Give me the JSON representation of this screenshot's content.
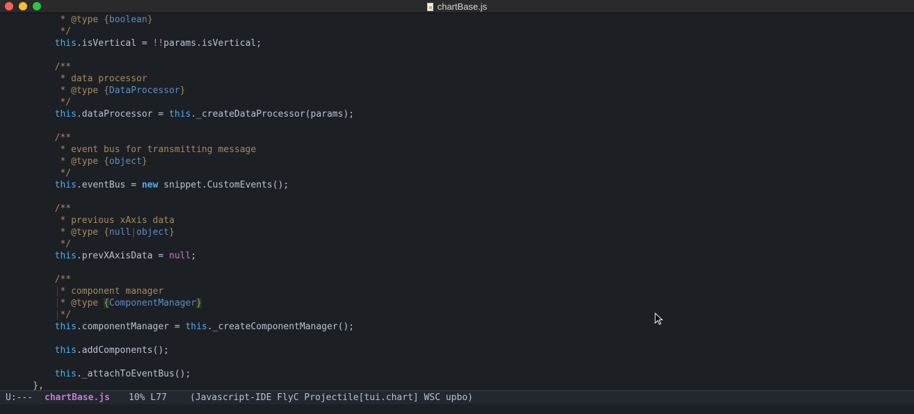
{
  "window": {
    "title": "chartBase.js",
    "traffic_lights": {
      "close": "#fe5f57",
      "minimize": "#febc2e",
      "maximize": "#28c840"
    }
  },
  "editor": {
    "theme": {
      "background": "#1c1f24",
      "comment": "#5b6268",
      "doc_text": "#a78a5c",
      "type": "#5b8fc7",
      "keyword": "#51afef",
      "constant": "#c678dd"
    },
    "lines": [
      {
        "tokens": [
          {
            "t": "         * @type ",
            "c": "tok-doctext"
          },
          {
            "t": "{",
            "c": "tok-brace"
          },
          {
            "t": "boolean",
            "c": "tok-type"
          },
          {
            "t": "}",
            "c": "tok-brace"
          }
        ]
      },
      {
        "tokens": [
          {
            "t": "         */",
            "c": "tok-doctext"
          }
        ]
      },
      {
        "tokens": [
          {
            "t": "        ",
            "c": "tok-ident"
          },
          {
            "t": "this",
            "c": "tok-this"
          },
          {
            "t": ".isVertical = ",
            "c": "tok-ident"
          },
          {
            "t": "!!",
            "c": "tok-bang"
          },
          {
            "t": "params.isVertical;",
            "c": "tok-ident"
          }
        ]
      },
      {
        "tokens": [
          {
            "t": "",
            "c": "tok-ident"
          }
        ]
      },
      {
        "tokens": [
          {
            "t": "        /**",
            "c": "tok-doctext"
          }
        ]
      },
      {
        "tokens": [
          {
            "t": "         * data processor",
            "c": "tok-doctext"
          }
        ]
      },
      {
        "tokens": [
          {
            "t": "         * @type ",
            "c": "tok-doctext"
          },
          {
            "t": "{",
            "c": "tok-brace"
          },
          {
            "t": "DataProcessor",
            "c": "tok-type"
          },
          {
            "t": "}",
            "c": "tok-brace"
          }
        ]
      },
      {
        "tokens": [
          {
            "t": "         */",
            "c": "tok-doctext"
          }
        ]
      },
      {
        "tokens": [
          {
            "t": "        ",
            "c": "tok-ident"
          },
          {
            "t": "this",
            "c": "tok-this"
          },
          {
            "t": ".dataProcessor = ",
            "c": "tok-ident"
          },
          {
            "t": "this",
            "c": "tok-this"
          },
          {
            "t": "._createDataProcessor(params);",
            "c": "tok-ident"
          }
        ]
      },
      {
        "tokens": [
          {
            "t": "",
            "c": "tok-ident"
          }
        ]
      },
      {
        "tokens": [
          {
            "t": "        /**",
            "c": "tok-doctext"
          }
        ]
      },
      {
        "tokens": [
          {
            "t": "         * event bus for transmitting message",
            "c": "tok-doctext"
          }
        ]
      },
      {
        "tokens": [
          {
            "t": "         * @type ",
            "c": "tok-doctext"
          },
          {
            "t": "{",
            "c": "tok-brace"
          },
          {
            "t": "object",
            "c": "tok-type"
          },
          {
            "t": "}",
            "c": "tok-brace"
          }
        ]
      },
      {
        "tokens": [
          {
            "t": "         */",
            "c": "tok-doctext"
          }
        ]
      },
      {
        "tokens": [
          {
            "t": "        ",
            "c": "tok-ident"
          },
          {
            "t": "this",
            "c": "tok-this"
          },
          {
            "t": ".eventBus = ",
            "c": "tok-ident"
          },
          {
            "t": "new",
            "c": "tok-kw"
          },
          {
            "t": " snippet.CustomEvents();",
            "c": "tok-ident"
          }
        ]
      },
      {
        "tokens": [
          {
            "t": "",
            "c": "tok-ident"
          }
        ]
      },
      {
        "tokens": [
          {
            "t": "        /**",
            "c": "tok-doctext"
          }
        ]
      },
      {
        "tokens": [
          {
            "t": "         * previous xAxis data",
            "c": "tok-doctext"
          }
        ]
      },
      {
        "tokens": [
          {
            "t": "         * @type ",
            "c": "tok-doctext"
          },
          {
            "t": "{",
            "c": "tok-brace"
          },
          {
            "t": "null",
            "c": "tok-type"
          },
          {
            "t": "|",
            "c": "tok-comment"
          },
          {
            "t": "object",
            "c": "tok-type"
          },
          {
            "t": "}",
            "c": "tok-brace"
          }
        ]
      },
      {
        "tokens": [
          {
            "t": "         */",
            "c": "tok-doctext"
          }
        ]
      },
      {
        "tokens": [
          {
            "t": "        ",
            "c": "tok-ident"
          },
          {
            "t": "this",
            "c": "tok-this"
          },
          {
            "t": ".prevXAxisData = ",
            "c": "tok-ident"
          },
          {
            "t": "null",
            "c": "tok-null"
          },
          {
            "t": ";",
            "c": "tok-ident"
          }
        ]
      },
      {
        "tokens": [
          {
            "t": "",
            "c": "tok-ident"
          }
        ]
      },
      {
        "tokens": [
          {
            "t": "        /**",
            "c": "tok-doctext"
          }
        ]
      },
      {
        "tokens": [
          {
            "t": "        ",
            "c": "tok-ident"
          },
          {
            "t": "|",
            "c": "guide"
          },
          {
            "t": "* component manager",
            "c": "tok-doctext"
          }
        ]
      },
      {
        "tokens": [
          {
            "t": "        ",
            "c": "tok-ident"
          },
          {
            "t": "|",
            "c": "guide"
          },
          {
            "t": "* @type ",
            "c": "tok-doctext"
          },
          {
            "t": "{",
            "c": "brace-hl"
          },
          {
            "t": "ComponentManager",
            "c": "tok-type"
          },
          {
            "t": "}",
            "c": "brace-hl"
          }
        ]
      },
      {
        "tokens": [
          {
            "t": "        ",
            "c": "tok-ident"
          },
          {
            "t": "|",
            "c": "guide"
          },
          {
            "t": "*/",
            "c": "tok-doctext"
          }
        ]
      },
      {
        "tokens": [
          {
            "t": "        ",
            "c": "tok-ident"
          },
          {
            "t": "this",
            "c": "tok-this"
          },
          {
            "t": ".componentManager = ",
            "c": "tok-ident"
          },
          {
            "t": "this",
            "c": "tok-this"
          },
          {
            "t": "._createComponentManager();",
            "c": "tok-ident"
          }
        ]
      },
      {
        "tokens": [
          {
            "t": "",
            "c": "tok-ident"
          }
        ]
      },
      {
        "tokens": [
          {
            "t": "        ",
            "c": "tok-ident"
          },
          {
            "t": "this",
            "c": "tok-this"
          },
          {
            "t": ".addComponents();",
            "c": "tok-ident"
          }
        ]
      },
      {
        "tokens": [
          {
            "t": "",
            "c": "tok-ident"
          }
        ]
      },
      {
        "tokens": [
          {
            "t": "        ",
            "c": "tok-ident"
          },
          {
            "t": "this",
            "c": "tok-this"
          },
          {
            "t": "._attachToEventBus();",
            "c": "tok-ident"
          }
        ]
      },
      {
        "tokens": [
          {
            "t": "    },",
            "c": "tok-ident"
          }
        ]
      }
    ]
  },
  "modeline": {
    "status": "U:---",
    "buffer_name": "chartBase.js",
    "position": "10% L77",
    "modes": "(Javascript-IDE FlyC Projectile[tui.chart] WSC upbo)"
  },
  "pointer": {
    "icon": "mouse-pointer-icon"
  }
}
